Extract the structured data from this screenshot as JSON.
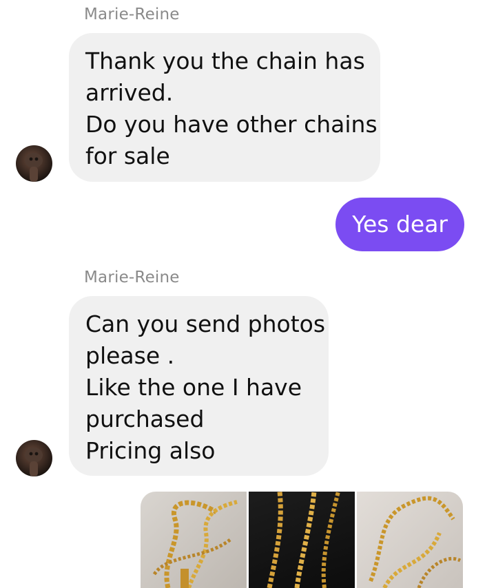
{
  "conversation": {
    "messages": [
      {
        "direction": "incoming",
        "sender": "Marie-Reine",
        "lines": [
          "Thank you the chain has",
          "arrived.",
          "Do you have other chains",
          "for sale"
        ]
      },
      {
        "direction": "outgoing",
        "text": "Yes dear"
      },
      {
        "direction": "incoming",
        "sender": "Marie-Reine",
        "lines": [
          "Can you send photos",
          "please .",
          "Like the one I have",
          "purchased",
          "Pricing also"
        ]
      }
    ],
    "photo_attachments": [
      {
        "icon": "gold-chain-photo"
      },
      {
        "icon": "gold-chain-photo"
      },
      {
        "icon": "gold-chain-photo"
      }
    ]
  },
  "colors": {
    "incoming_bubble": "#f0f0f0",
    "outgoing_bubble": "#7b4cf2",
    "sender_name": "#8a8a8a",
    "background": "#ffffff"
  }
}
